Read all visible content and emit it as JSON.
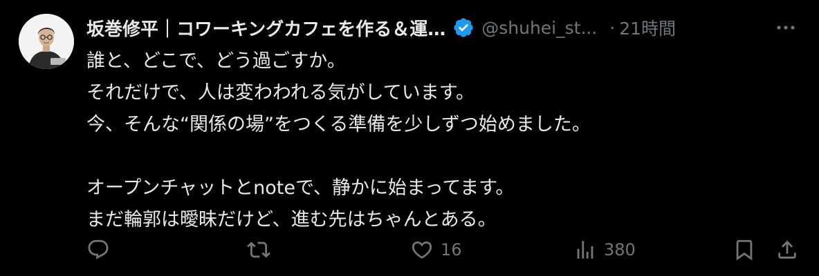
{
  "tweet": {
    "author": {
      "display_name": "坂巻修平｜コワーキングカフェを作る＆運…",
      "handle": "@shuhei_st...",
      "verified_icon": "verified-badge-icon"
    },
    "separator": "·",
    "time": "21時間",
    "text_lines": [
      "誰と、どこで、どう過ごすか。",
      "それだけで、人は変わわれる気がしています。",
      "今、そんな“関係の場”をつくる準備を少しずつ始めました。",
      "",
      "オープンチャットとnoteで、静かに始まってます。",
      "まだ輪郭は曖昧だけど、進む先はちゃんとある。"
    ],
    "actions": {
      "reply": {
        "icon": "reply-icon",
        "count": ""
      },
      "repost": {
        "icon": "repost-icon",
        "count": ""
      },
      "like": {
        "icon": "heart-icon",
        "count": "16"
      },
      "views": {
        "icon": "views-chart-icon",
        "count": "380"
      },
      "bookmark": {
        "icon": "bookmark-icon"
      },
      "share": {
        "icon": "share-icon"
      }
    }
  },
  "colors": {
    "background": "#000000",
    "primary_text": "#e7e9ea",
    "secondary_text": "#71767b",
    "verified_blue": "#1d9bf0"
  }
}
